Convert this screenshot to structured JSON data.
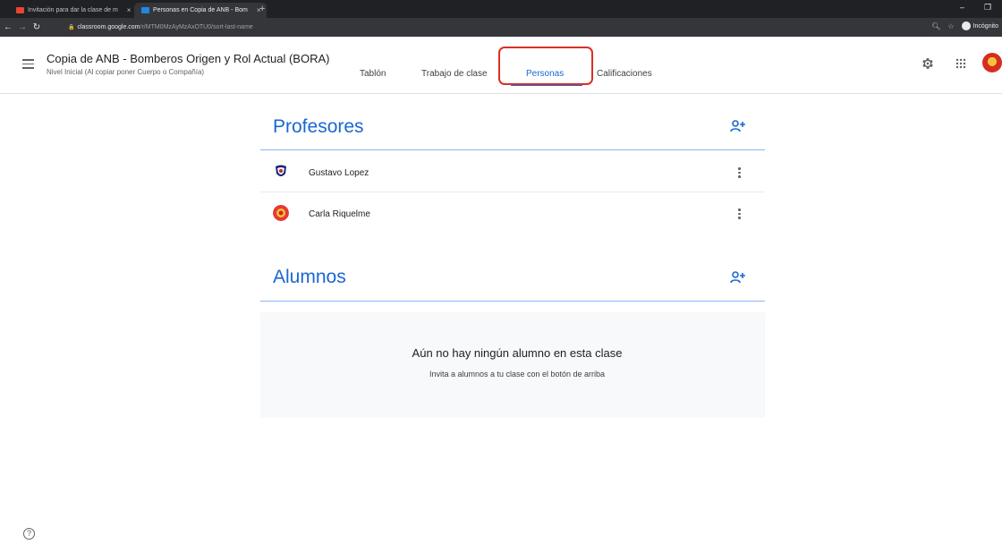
{
  "browser": {
    "tabs": [
      {
        "title": "Invitación para dar la clase de m",
        "favicon_color": "#ea4335"
      },
      {
        "title": "Personas en Copia de ANB - Bom",
        "favicon_color": "#1e88e5"
      }
    ],
    "new_tab_icon": "+",
    "url_domain": "classroom.google.com",
    "url_path": "/r/MTM0MzAyMzAxOTU0/sort-last-name",
    "incognito_label": "Incógnito"
  },
  "header": {
    "class_title": "Copia de ANB - Bomberos Origen y Rol Actual (BORA)",
    "class_subtitle": "Nivel Inicial (Al copiar poner Cuerpo o Compañía)",
    "tabs": [
      {
        "label": "Tablón"
      },
      {
        "label": "Trabajo de clase"
      },
      {
        "label": "Personas",
        "active": true
      },
      {
        "label": "Calificaciones"
      }
    ],
    "icons": [
      "menu-icon",
      "settings-icon",
      "apps-icon",
      "avatar"
    ]
  },
  "teachers": {
    "title": "Profesores",
    "people": [
      {
        "name": "Gustavo Lopez"
      },
      {
        "name": "Carla Riquelme"
      }
    ]
  },
  "students": {
    "title": "Alumnos",
    "empty_title": "Aún no hay ningún alumno en esta clase",
    "empty_subtitle": "Invita a alumnos a tu clase con el botón de arriba"
  },
  "colors": {
    "accent": "#1967d2",
    "highlight": "#d93025"
  }
}
